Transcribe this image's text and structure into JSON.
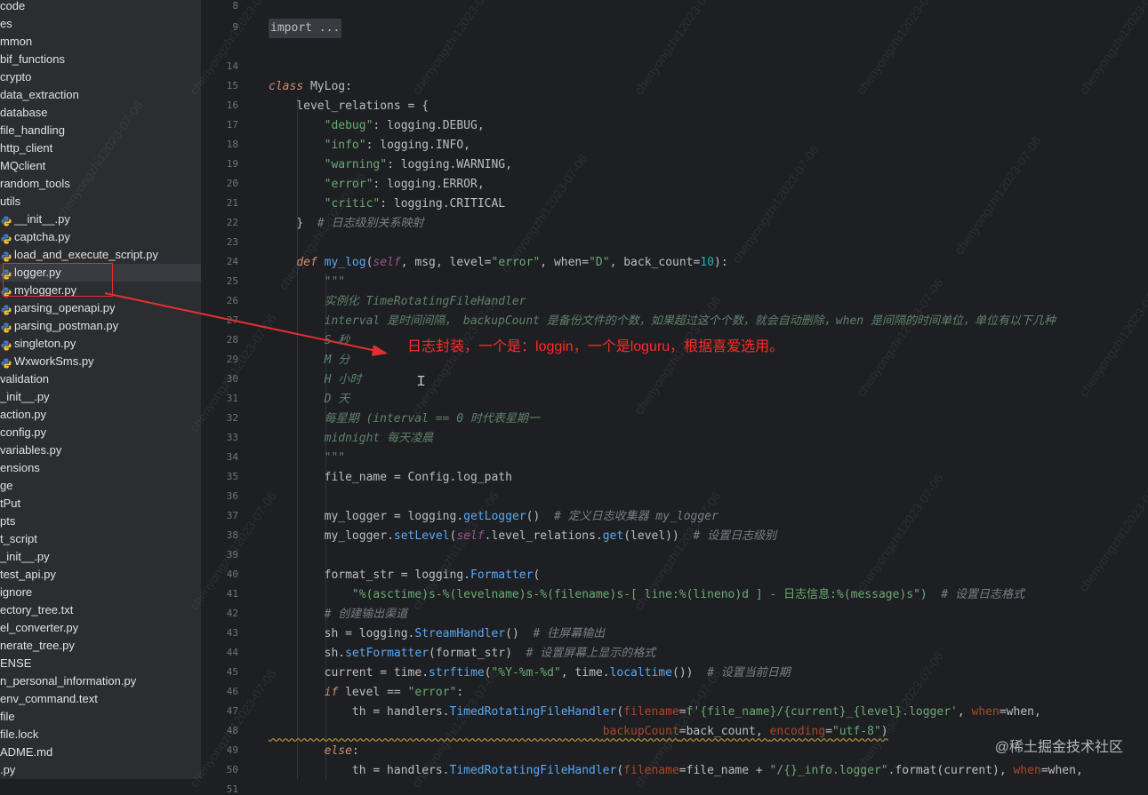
{
  "sidebar": {
    "items": [
      {
        "label": "code",
        "icon": "",
        "selected": false
      },
      {
        "label": "es",
        "icon": "",
        "selected": false
      },
      {
        "label": "mmon",
        "icon": "",
        "selected": false
      },
      {
        "label": "bif_functions",
        "icon": "",
        "selected": false
      },
      {
        "label": "crypto",
        "icon": "",
        "selected": false
      },
      {
        "label": "data_extraction",
        "icon": "",
        "selected": false
      },
      {
        "label": "database",
        "icon": "",
        "selected": false
      },
      {
        "label": "file_handling",
        "icon": "",
        "selected": false
      },
      {
        "label": "http_client",
        "icon": "",
        "selected": false
      },
      {
        "label": "MQclient",
        "icon": "",
        "selected": false
      },
      {
        "label": "random_tools",
        "icon": "",
        "selected": false
      },
      {
        "label": "utils",
        "icon": "",
        "selected": false
      },
      {
        "label": "__init__.py",
        "icon": "python-file-icon",
        "selected": false
      },
      {
        "label": "captcha.py",
        "icon": "python-file-icon",
        "selected": false
      },
      {
        "label": "load_and_execute_script.py",
        "icon": "python-file-icon",
        "selected": false
      },
      {
        "label": "logger.py",
        "icon": "python-file-icon",
        "selected": true
      },
      {
        "label": "mylogger.py",
        "icon": "python-file-icon",
        "selected": false
      },
      {
        "label": "parsing_openapi.py",
        "icon": "python-file-icon",
        "selected": false
      },
      {
        "label": "parsing_postman.py",
        "icon": "python-file-icon",
        "selected": false
      },
      {
        "label": "singleton.py",
        "icon": "python-file-icon",
        "selected": false
      },
      {
        "label": "WxworkSms.py",
        "icon": "python-file-icon",
        "selected": false
      },
      {
        "label": "validation",
        "icon": "",
        "selected": false
      },
      {
        "label": "_init__.py",
        "icon": "",
        "selected": false
      },
      {
        "label": "action.py",
        "icon": "",
        "selected": false
      },
      {
        "label": "config.py",
        "icon": "",
        "selected": false
      },
      {
        "label": "variables.py",
        "icon": "",
        "selected": false
      },
      {
        "label": "ensions",
        "icon": "",
        "selected": false
      },
      {
        "label": "ge",
        "icon": "",
        "selected": false
      },
      {
        "label": "tPut",
        "icon": "",
        "selected": false
      },
      {
        "label": "pts",
        "icon": "",
        "selected": false
      },
      {
        "label": "t_script",
        "icon": "",
        "selected": false
      },
      {
        "label": "_init__.py",
        "icon": "",
        "selected": false
      },
      {
        "label": "test_api.py",
        "icon": "",
        "selected": false
      },
      {
        "label": "ignore",
        "icon": "",
        "selected": false
      },
      {
        "label": "ectory_tree.txt",
        "icon": "",
        "selected": false
      },
      {
        "label": "el_converter.py",
        "icon": "",
        "selected": false
      },
      {
        "label": "nerate_tree.py",
        "icon": "",
        "selected": false
      },
      {
        "label": "ENSE",
        "icon": "",
        "selected": false
      },
      {
        "label": "n_personal_information.py",
        "icon": "",
        "selected": false
      },
      {
        "label": "env_command.text",
        "icon": "",
        "selected": false
      },
      {
        "label": "file",
        "icon": "",
        "selected": false
      },
      {
        "label": "file.lock",
        "icon": "",
        "selected": false
      },
      {
        "label": "ADME.md",
        "icon": "",
        "selected": false
      },
      {
        "label": ".py",
        "icon": "",
        "selected": false
      }
    ]
  },
  "editor": {
    "line_numbers": [
      "8",
      "9",
      "14",
      "15",
      "16",
      "17",
      "18",
      "19",
      "20",
      "21",
      "22",
      "23",
      "24",
      "25",
      "26",
      "27",
      "28",
      "29",
      "30",
      "31",
      "32",
      "33",
      "34",
      "35",
      "36",
      "37",
      "38",
      "39",
      "40",
      "41",
      "42",
      "43",
      "44",
      "45",
      "46",
      "47",
      "48",
      "49",
      "50",
      "51"
    ],
    "fold_text": "import ...",
    "lines": {
      "l16": "MyLog",
      "l17": "level_relations = {",
      "l18k": "\"debug\"",
      "l18v": ": logging.DEBUG,",
      "l19k": "\"info\"",
      "l19v": ": logging.INFO,",
      "l20k": "\"warning\"",
      "l20v": ": logging.WARNING,",
      "l21k": "\"error\"",
      "l21v": ": logging.ERROR,",
      "l22k": "\"critic\"",
      "l22v": ": logging.CRITICAL",
      "l23a": "}",
      "l23c": "# 日志级别关系映射",
      "l25fn": "my_log",
      "l25p1": "msg",
      "l25p2": "level",
      "l25s1": "\"error\"",
      "l25p3": "when",
      "l25s2": "\"D\"",
      "l25p4": "back_count",
      "l25n": "10",
      "l26": "\"\"\"",
      "l27": "实例化 TimeRotatingFileHandler",
      "l28": "interval 是时间间隔， backupCount 是备份文件的个数，如果超过这个个数，就会自动删除，when 是间隔的时间单位，单位有以下几种",
      "l29": "S 秒",
      "l30": "M 分",
      "l31": "H 小时",
      "l32": "D 天",
      "l33": "每星期 (interval == 0 时代表星期一",
      "l34": "midnight 每天凌晨",
      "l35": "\"\"\"",
      "l36": "file_name = Config.log_path",
      "l38a": "my_logger = logging.",
      "l38b": "getLogger",
      "l38c": "()",
      "l38d": "# 定义日志收集器 my_logger",
      "l39a": "my_logger.",
      "l39b": "setLevel",
      "l39c": "(",
      "l39d": ".level_relations.",
      "l39e": "get",
      "l39f": "(level))",
      "l39g": "# 设置日志级别",
      "l41a": "format_str = logging.",
      "l41b": "Formatter",
      "l41c": "(",
      "l42s": "\"%(asctime)s-%(levelname)s-%(filename)s-[ line:%(lineno)d ] - 日志信息:%(message)s\")",
      "l42c": "# 设置日志格式",
      "l43": "# 创建输出渠道",
      "l44a": "sh = logging.",
      "l44b": "StreamHandler",
      "l44c": "()",
      "l44d": "# 往屏幕输出",
      "l45a": "sh.",
      "l45b": "setFormatter",
      "l45c": "(format_str)",
      "l45d": "# 设置屏幕上显示的格式",
      "l46a": "current = time.",
      "l46b": "strftime",
      "l46c": "(",
      "l46s": "\"%Y-%m-%d\"",
      "l46d": ", time.",
      "l46e": "localtime",
      "l46f": "())",
      "l46g": "# 设置当前日期",
      "l47a": "level == ",
      "l47s": "\"error\"",
      "l47b": ":",
      "l48a": "th = handlers.",
      "l48b": "TimedRotatingFileHandler",
      "l48c": "(",
      "l48p": "filename",
      "l48d": "=",
      "l48s": "f'{file_name}/{current}_{level}.logger'",
      "l48e": ", ",
      "l48p2": "when",
      "l48f": "=when,",
      "l49p": "backupCount",
      "l49a": "=back_count, ",
      "l49p2": "encoding",
      "l49b": "=",
      "l49s": "\"utf-8\"",
      "l49c": ")",
      "l50": "else",
      "l51a": "th = handlers.",
      "l51b": "TimedRotatingFileHandler",
      "l51c": "(",
      "l51p": "filename",
      "l51d": "=file_name + ",
      "l51s": "\"/{}_info.logger\"",
      "l51e": ".format(current), ",
      "l51p2": "when",
      "l51f": "=when,"
    }
  },
  "annotation": {
    "text": "日志封装，一个是：loggin，一个是loguru，根据喜爱选用。",
    "color": "#ff2a2a"
  },
  "watermarks": {
    "repeat": "chenyongzhi12023-07-06",
    "corner": "@稀土掘金技术社区"
  }
}
